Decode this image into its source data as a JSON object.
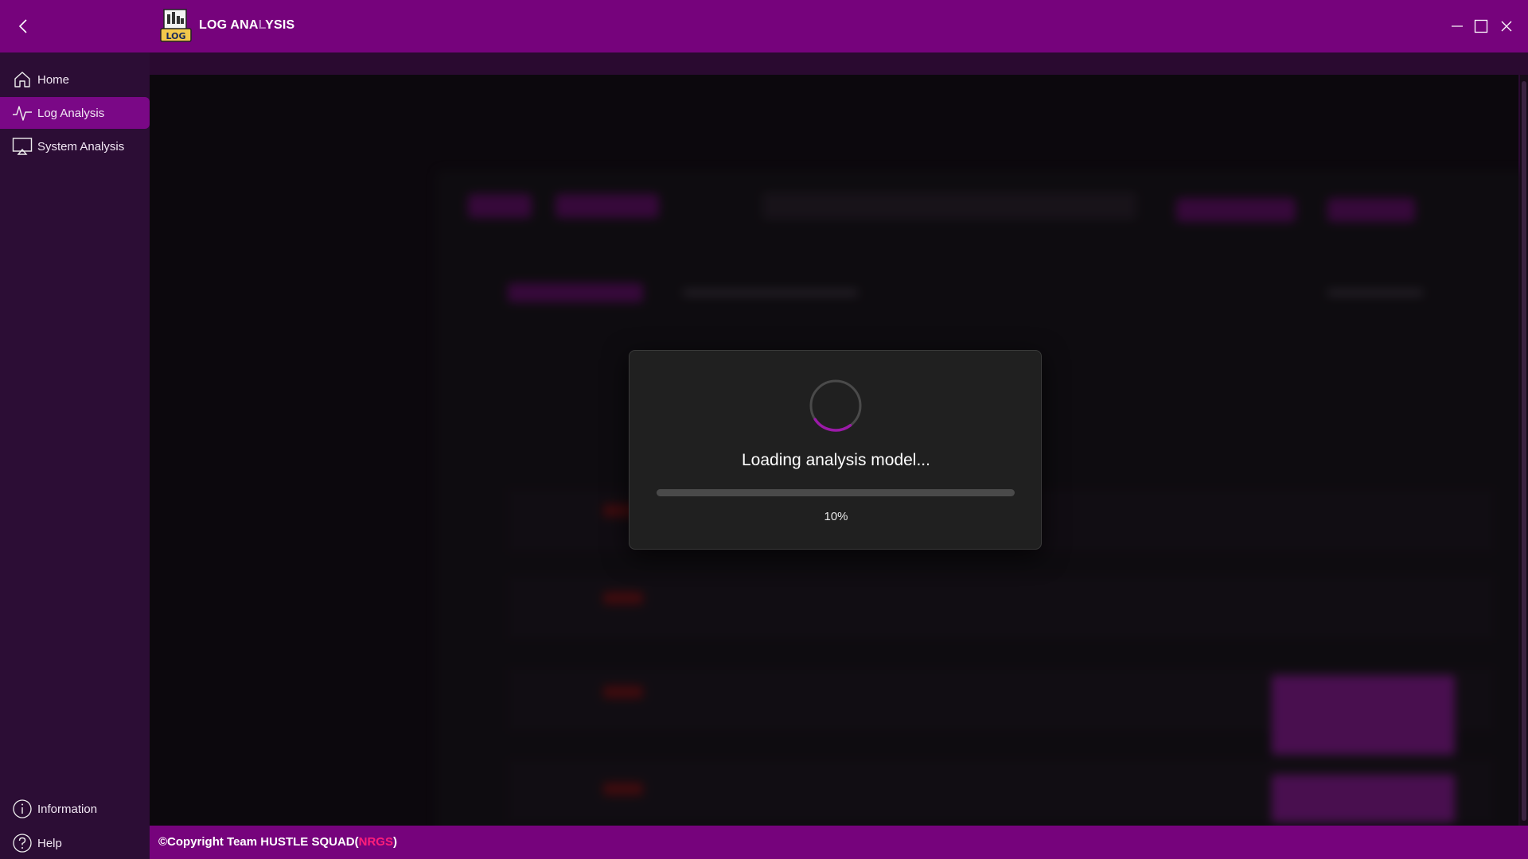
{
  "app": {
    "title_part1": "LOG ANA",
    "title_part2": "L",
    "title_part3": "YSIS",
    "logo_label": "LOG"
  },
  "sidebar": {
    "items": [
      {
        "label": "Home",
        "icon": "home-icon",
        "active": false
      },
      {
        "label": "Log Analysis",
        "icon": "activity-icon",
        "active": true
      },
      {
        "label": "System Analysis",
        "icon": "monitor-icon",
        "active": false
      }
    ],
    "bottom_items": [
      {
        "label": "Information",
        "icon": "info-icon"
      },
      {
        "label": "Help",
        "icon": "help-icon"
      }
    ]
  },
  "dialog": {
    "message": "Loading analysis model...",
    "progress_percent": 10,
    "progress_text": "10%"
  },
  "footer": {
    "text": "©Copyright Team HUSTLE SQUAD(",
    "accent": "NRGS",
    "closing": ")"
  },
  "colors": {
    "titlebar": "#76037c",
    "sidebar": "#2c0d35",
    "active_nav": "#7a0886",
    "dialog_bg": "#202020",
    "footer_accent": "#ff1f7a"
  }
}
